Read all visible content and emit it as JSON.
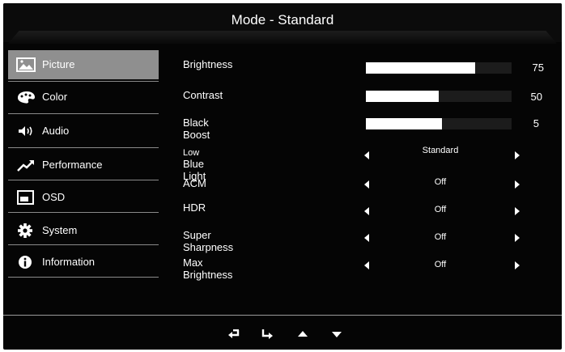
{
  "title": "Mode - Standard",
  "sidebar": {
    "items": [
      {
        "label": "Picture",
        "icon": "picture-icon",
        "active": true
      },
      {
        "label": "Color",
        "icon": "palette-icon"
      },
      {
        "label": "Audio",
        "icon": "speaker-icon"
      },
      {
        "label": "Performance",
        "icon": "trend-up-icon"
      },
      {
        "label": "OSD",
        "icon": "osd-window-icon"
      },
      {
        "label": "System",
        "icon": "gear-icon"
      },
      {
        "label": "Information",
        "icon": "info-icon"
      }
    ]
  },
  "settings": {
    "brightness": {
      "label": "Brightness",
      "value": "75",
      "fraction": 0.75
    },
    "contrast": {
      "label": "Contrast",
      "value": "50",
      "fraction": 0.5
    },
    "black_boost": {
      "label": "Black Boost",
      "value": "5",
      "fraction": 0.52
    },
    "low_blue_light": {
      "label_prefix": "Low",
      "label": "Blue Light",
      "value": "Standard"
    },
    "acm": {
      "label": "ACM",
      "value": "Off"
    },
    "hdr": {
      "label": "HDR",
      "value": "Off"
    },
    "super_sharpness": {
      "label": "Super Sharpness",
      "value": "Off"
    },
    "max_brightness": {
      "label": "Max Brightness",
      "value": "Off"
    }
  },
  "nav": [
    "back-icon",
    "enter-icon",
    "up-arrow-icon",
    "down-arrow-icon"
  ],
  "colors": {
    "background": "#050505",
    "active_tab": "#8f8f8f",
    "text": "#ffffff"
  }
}
